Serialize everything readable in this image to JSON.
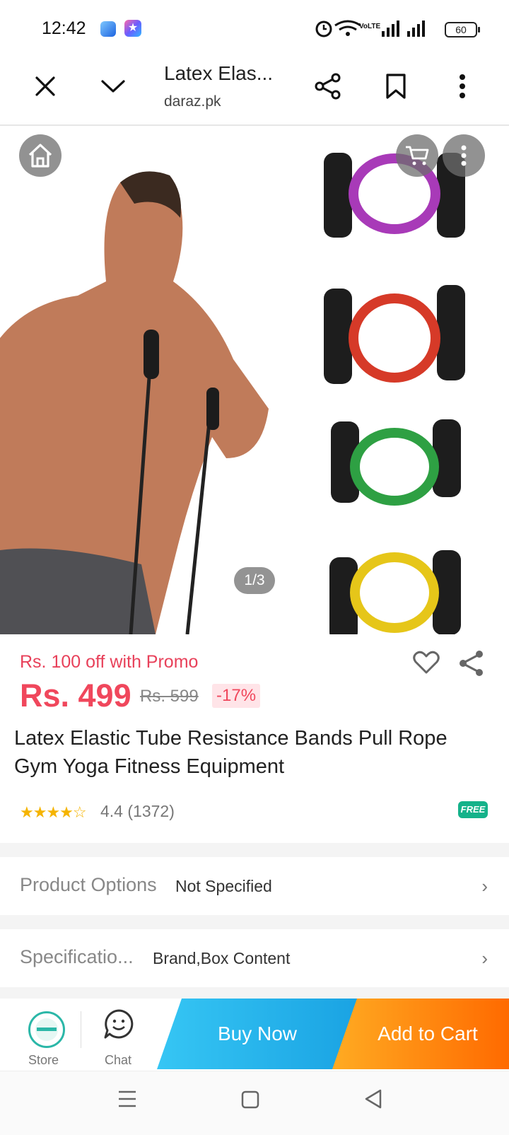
{
  "status_bar": {
    "time": "12:42",
    "battery": "60",
    "network_label": "VoLTE"
  },
  "browser": {
    "page_title": "Latex Elas...",
    "domain": "daraz.pk"
  },
  "gallery": {
    "counter": "1/3"
  },
  "product": {
    "promo": "Rs. 100 off with Promo",
    "price": "Rs. 499",
    "old_price": "Rs. 599",
    "discount": "-17%",
    "title": "Latex Elastic Tube Resistance Bands Pull Rope Gym Yoga Fitness Equipment",
    "stars": "★★★★☆",
    "rating": "4.4 (1372)",
    "free_badge": "FREE"
  },
  "options": {
    "product_options_label": "Product Options",
    "product_options_value": "Not Specified",
    "specification_label": "Specificatio...",
    "specification_value": "Brand,Box Content"
  },
  "actions": {
    "store": "Store",
    "chat": "Chat",
    "buy_now": "Buy Now",
    "add_to_cart": "Add to Cart"
  },
  "colors": {
    "accent_red": "#f0475c",
    "buy_blue": "#1aa3e3",
    "cart_orange": "#ff6a00",
    "free_green": "#15b28a"
  },
  "icons": [
    "close-icon",
    "chevron-down-icon",
    "share-icon",
    "bookmark-icon",
    "more-icon",
    "home-icon",
    "cart-icon",
    "heart-icon",
    "chat-icon",
    "menu-icon",
    "square-icon",
    "back-triangle-icon"
  ]
}
